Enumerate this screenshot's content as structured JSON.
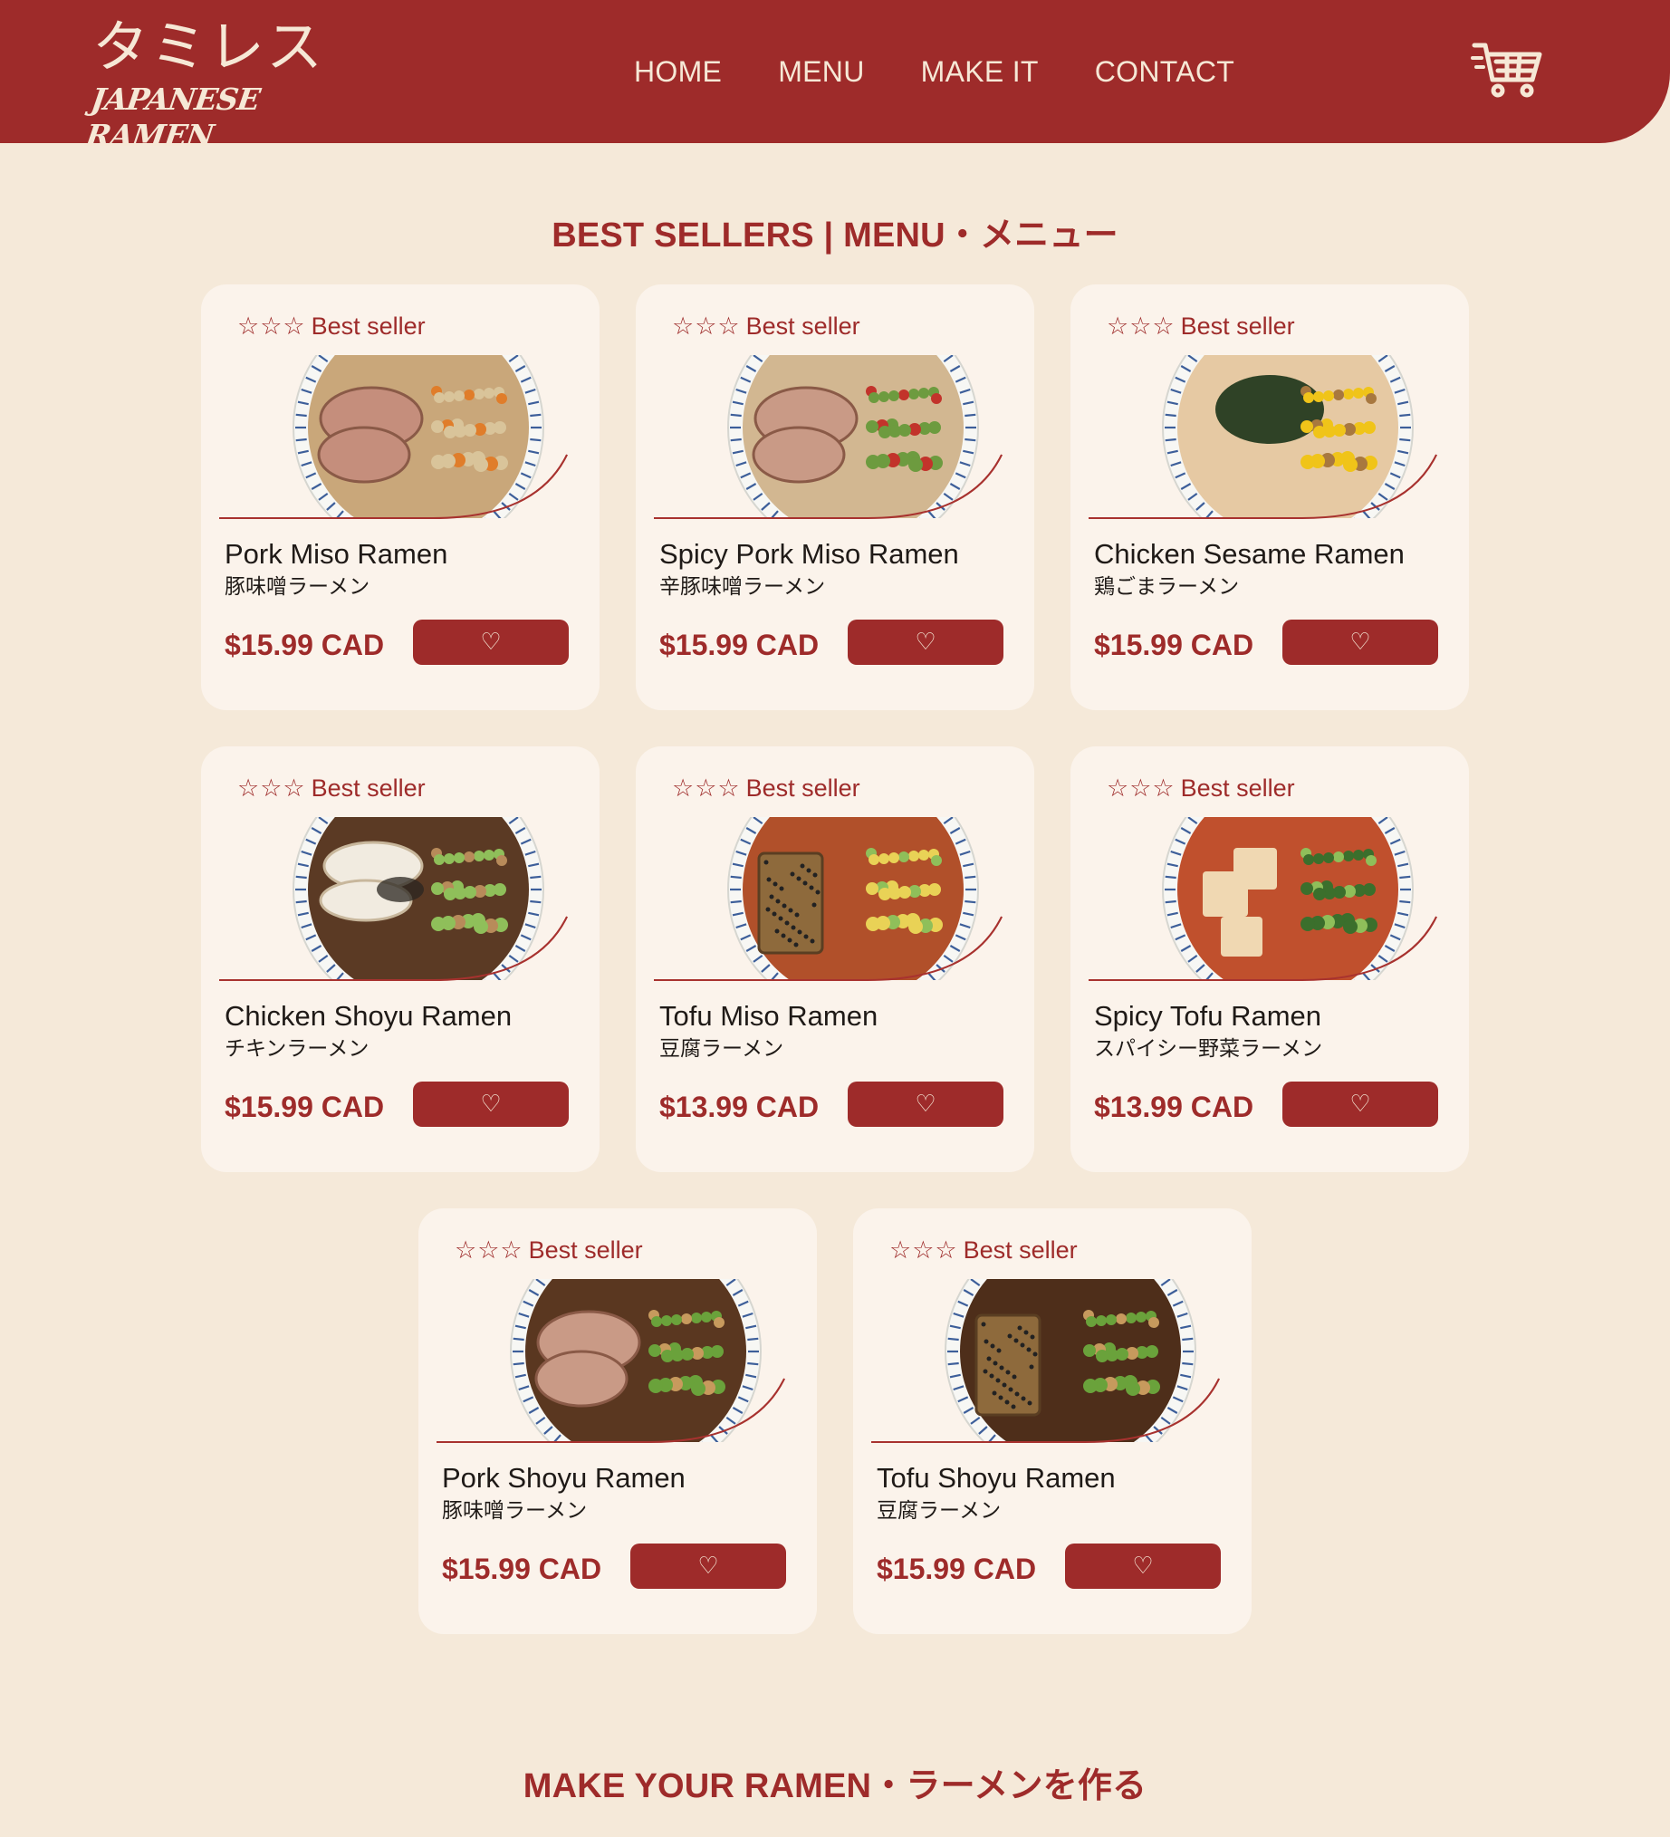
{
  "brand": {
    "logo_jp": "タミレス",
    "logo_en": "JAPANESE RAMEN"
  },
  "nav": {
    "items": [
      "HOME",
      "MENU",
      "MAKE IT",
      "CONTACT"
    ]
  },
  "cart": {
    "icon": "cart-icon"
  },
  "colors": {
    "primary": "#9e2b2a",
    "background": "#f5e9d9",
    "card": "#fbf3eb",
    "cream_text": "#f6e8d6"
  },
  "bestsellers": {
    "title": "BEST SELLERS | MENU・メニュー",
    "badge_stars": "☆☆☆",
    "badge_label": "Best seller",
    "fav_icon": "♡",
    "items": [
      {
        "name": "Pork Miso Ramen",
        "jp": "豚味噌ラーメン",
        "price": "$15.99 CAD"
      },
      {
        "name": "Spicy Pork Miso Ramen",
        "jp": "辛豚味噌ラーメン",
        "price": "$15.99 CAD"
      },
      {
        "name": "Chicken Sesame Ramen",
        "jp": "鶏ごまラーメン",
        "price": "$15.99 CAD"
      },
      {
        "name": "Chicken Shoyu Ramen",
        "jp": "チキンラーメン",
        "price": "$15.99 CAD"
      },
      {
        "name": "Tofu Miso Ramen",
        "jp": "豆腐ラーメン",
        "price": "$13.99 CAD"
      },
      {
        "name": "Spicy Tofu Ramen",
        "jp": "スパイシー野菜ラーメン",
        "price": "$13.99 CAD"
      },
      {
        "name": "Pork Shoyu Ramen",
        "jp": "豚味噌ラーメン",
        "price": "$15.99 CAD"
      },
      {
        "name": "Tofu Shoyu Ramen",
        "jp": "豆腐ラーメン",
        "price": "$15.99 CAD"
      }
    ]
  },
  "make_section": {
    "title": "MAKE YOUR RAMEN・ラーメンを作る"
  }
}
